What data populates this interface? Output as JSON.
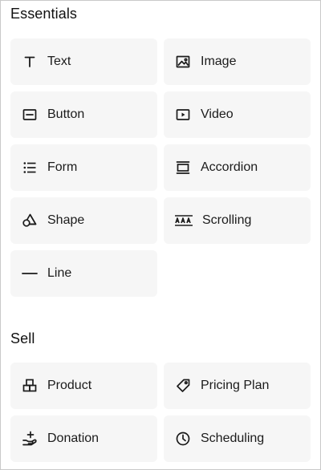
{
  "sections": [
    {
      "title": "Essentials",
      "items": [
        {
          "label": "Text",
          "icon": "text-icon"
        },
        {
          "label": "Image",
          "icon": "image-icon"
        },
        {
          "label": "Button",
          "icon": "button-icon"
        },
        {
          "label": "Video",
          "icon": "video-icon"
        },
        {
          "label": "Form",
          "icon": "form-icon"
        },
        {
          "label": "Accordion",
          "icon": "accordion-icon"
        },
        {
          "label": "Shape",
          "icon": "shape-icon"
        },
        {
          "label": "Scrolling",
          "icon": "scrolling-icon"
        },
        {
          "label": "Line",
          "icon": "line-icon"
        }
      ]
    },
    {
      "title": "Sell",
      "items": [
        {
          "label": "Product",
          "icon": "product-icon"
        },
        {
          "label": "Pricing Plan",
          "icon": "tag-icon"
        },
        {
          "label": "Donation",
          "icon": "donation-icon"
        },
        {
          "label": "Scheduling",
          "icon": "clock-icon"
        }
      ]
    }
  ]
}
